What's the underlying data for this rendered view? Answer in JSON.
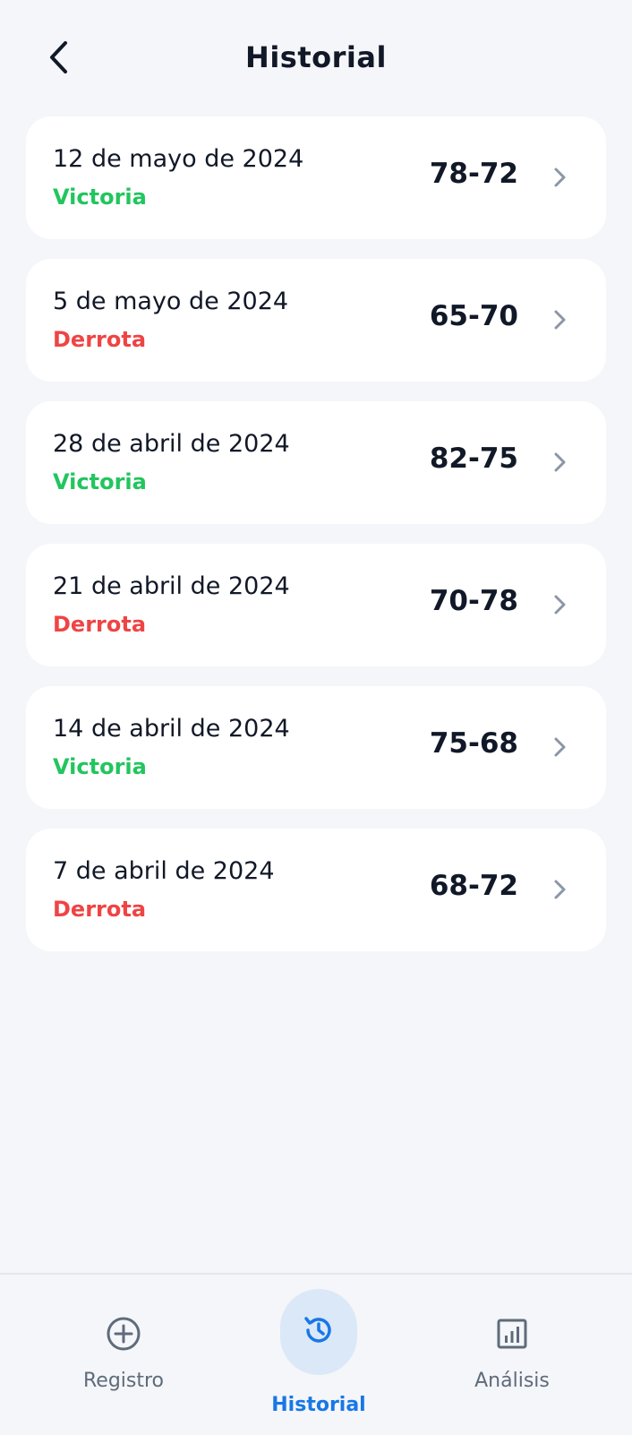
{
  "header": {
    "title": "Historial"
  },
  "games": [
    {
      "date": "12 de mayo de 2024",
      "result": "Victoria",
      "score": "78-72",
      "outcome": "win"
    },
    {
      "date": "5 de mayo de 2024",
      "result": "Derrota",
      "score": "65-70",
      "outcome": "loss"
    },
    {
      "date": "28 de abril de 2024",
      "result": "Victoria",
      "score": "82-75",
      "outcome": "win"
    },
    {
      "date": "21 de abril de 2024",
      "result": "Derrota",
      "score": "70-78",
      "outcome": "loss"
    },
    {
      "date": "14 de abril de 2024",
      "result": "Victoria",
      "score": "75-68",
      "outcome": "win"
    },
    {
      "date": "7 de abril de 2024",
      "result": "Derrota",
      "score": "68-72",
      "outcome": "loss"
    }
  ],
  "nav": {
    "registro": {
      "label": "Registro",
      "icon": "plus-circle-icon"
    },
    "historial": {
      "label": "Historial",
      "icon": "history-icon",
      "active": true
    },
    "analisis": {
      "label": "Análisis",
      "icon": "bar-chart-icon"
    }
  },
  "colors": {
    "win": "#22c55e",
    "loss": "#ef4444",
    "accent": "#1877e6",
    "background": "#f4f6f9"
  }
}
